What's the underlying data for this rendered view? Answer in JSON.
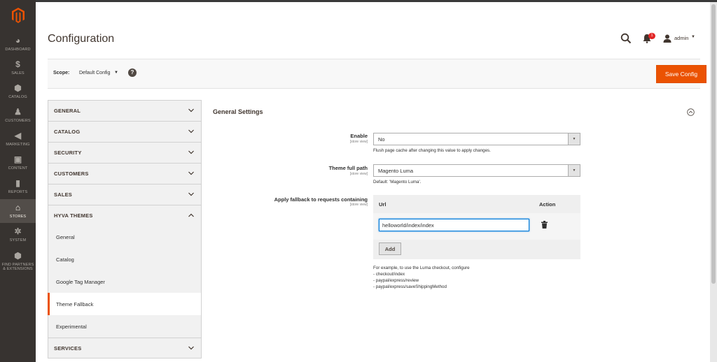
{
  "sidebar": {
    "items": [
      {
        "label": "DASHBOARD",
        "icon": "dashboard-icon",
        "glyph": "◕"
      },
      {
        "label": "SALES",
        "icon": "dollar-icon",
        "glyph": "$"
      },
      {
        "label": "CATALOG",
        "icon": "catalog-box-icon",
        "glyph": "⬢"
      },
      {
        "label": "CUSTOMERS",
        "icon": "customer-person-icon",
        "glyph": "♟"
      },
      {
        "label": "MARKETING",
        "icon": "megaphone-icon",
        "glyph": "◀"
      },
      {
        "label": "CONTENT",
        "icon": "content-layout-icon",
        "glyph": "▣"
      },
      {
        "label": "REPORTS",
        "icon": "bar-chart-icon",
        "glyph": "▮"
      },
      {
        "label": "STORES",
        "icon": "store-icon",
        "glyph": "⌂"
      },
      {
        "label": "SYSTEM",
        "icon": "gear-icon",
        "glyph": "✲"
      },
      {
        "label": "FIND PARTNERS & EXTENSIONS",
        "icon": "extensions-box-icon",
        "glyph": "⬢"
      }
    ],
    "active_index": 7
  },
  "header": {
    "title": "Configuration",
    "notification_count": "1",
    "user": "admin"
  },
  "scope": {
    "label": "Scope:",
    "value": "Default Config",
    "help": "?"
  },
  "toolbar": {
    "save_label": "Save Config"
  },
  "tabs": {
    "general": "GENERAL",
    "catalog": "CATALOG",
    "security": "SECURITY",
    "customers": "CUSTOMERS",
    "sales": "SALES",
    "hyva": "HYVA THEMES",
    "hyva_items": [
      "General",
      "Catalog",
      "Google Tag Manager",
      "Theme Fallback",
      "Experimental"
    ],
    "hyva_active_index": 3,
    "services": "SERVICES"
  },
  "section": {
    "title": "General Settings",
    "fields": {
      "enable": {
        "label": "Enable",
        "scope": "[store view]",
        "value": "No",
        "note": "Flush page cache after changing this value to apply changes."
      },
      "theme_path": {
        "label": "Theme full path",
        "scope": "[store view]",
        "value": "Magento Luma",
        "note": "Default: 'Magento Luma'."
      },
      "fallback": {
        "label": "Apply fallback to requests containing",
        "scope": "[store view]",
        "col_url": "Url",
        "col_action": "Action",
        "row_value": "helloworld/index/index",
        "add_label": "Add",
        "example_lines": [
          "For example, to use the Luma checkout, configure",
          "- checkout/index",
          "- paypal/express/review",
          "- paypal/express/saveShippingMethod"
        ]
      }
    }
  },
  "colors": {
    "accent": "#eb5202",
    "sidebar_bg": "#373330",
    "focus_blue": "#007bdb"
  }
}
